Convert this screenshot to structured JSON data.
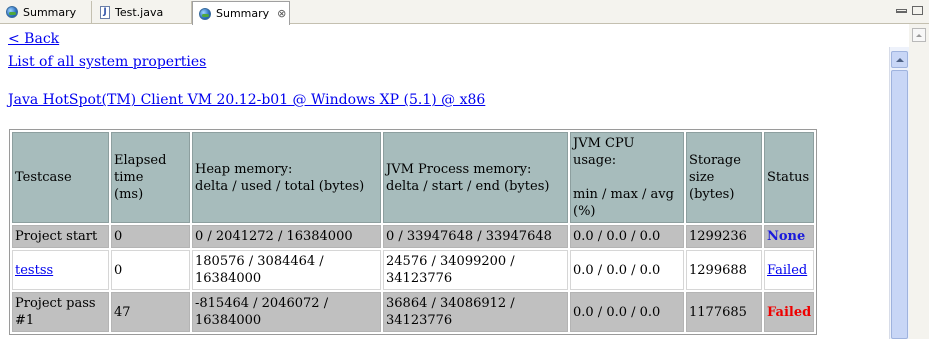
{
  "tabs": [
    {
      "label": "Summary",
      "icon": "globe-icon"
    },
    {
      "label": "Test.java",
      "icon": "java-file-icon"
    },
    {
      "label": "Summary",
      "icon": "globe-icon",
      "active": true,
      "close": "⊗"
    }
  ],
  "links": {
    "back": "< Back",
    "system_properties": "List of all system properties",
    "vm": "Java HotSpot(TM) Client VM 20.12-b01 @ Windows XP (5.1) @ x86"
  },
  "table": {
    "headers": {
      "testcase": "Testcase",
      "elapsed": [
        "Elapsed",
        "time",
        "(ms)"
      ],
      "heap": [
        "Heap memory:",
        "delta / used / total (bytes)"
      ],
      "jvm_process": [
        "JVM Process memory:",
        "delta / start / end (bytes)"
      ],
      "jvm_cpu": [
        "JVM CPU usage:",
        "",
        "min / max / avg",
        "(%)"
      ],
      "storage": [
        "Storage",
        "size",
        "(bytes)"
      ],
      "status": "Status"
    },
    "rows": [
      {
        "testcase": "Project start",
        "elapsed": "0",
        "heap": [
          "0 / 2041272 / 16384000"
        ],
        "jvm_process": [
          "0 / 33947648 / 33947648"
        ],
        "cpu": "0.0 / 0.0 / 0.0",
        "storage": "1299236",
        "status": "None"
      },
      {
        "testcase": "testss",
        "elapsed": "0",
        "heap": [
          "180576 / 3084464 /",
          "16384000"
        ],
        "jvm_process": [
          "24576 / 34099200 /",
          "34123776"
        ],
        "cpu": "0.0 / 0.0 / 0.0",
        "storage": "1299688",
        "status": "Failed"
      },
      {
        "testcase": [
          "Project pass",
          "#1"
        ],
        "elapsed": "47",
        "heap": [
          "-815464 / 2046072 /",
          "16384000"
        ],
        "jvm_process": [
          "36864 / 34086912 /",
          "34123776"
        ],
        "cpu": "0.0 / 0.0 / 0.0",
        "storage": "1177685",
        "status": "Failed"
      }
    ]
  },
  "colors": {
    "header_bg": "#a7bcbc",
    "row_grey": "#c0c0c0",
    "link": "#0000ee",
    "status_none": "#1a1adc",
    "status_failed": "#ee0000"
  }
}
